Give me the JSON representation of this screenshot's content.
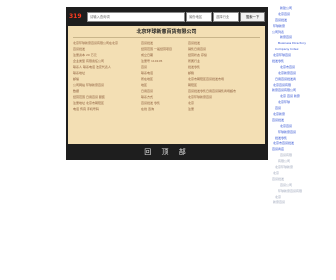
{
  "search": {
    "logo": "319",
    "keyword_placeholder": "请输入查询词",
    "area_placeholder": "省份地区",
    "industry_placeholder": "选择行业",
    "button": "搜索一下"
  },
  "company": {
    "name": "北京环球新意百货有限公司",
    "rows": [
      [
        "北京环球新意百货有限公司在北京",
        "百货批发",
        "百货批发"
      ],
      [
        "百货批发",
        "经营范围 一般经营项目",
        "销售日用百货"
      ],
      [
        "注册资本 20 万元",
        "成立日期",
        "经营状态 存续"
      ],
      [
        "企业类型 有限责任公司",
        "注册号 110105",
        "所属行业"
      ],
      [
        "联系人 联系电话 法定代表人",
        "百货",
        "批发零售"
      ],
      [
        "联系地址",
        "联系电话",
        "邮箱"
      ],
      [
        "邮编",
        "所在地区",
        "北京市朝阳区百货批发市场"
      ],
      [
        "公司网站 环球新意百货",
        "地区",
        "朝阳区"
      ],
      [
        "数据",
        "日用百货",
        "百货批发零售日用百货销售商场超市"
      ],
      [
        "经营范围 日用百货 服装",
        "联系方式",
        "北京环球新意百货"
      ],
      [
        "注册地址 北京市朝阳区",
        "百货批发 零售",
        "北京"
      ],
      [
        "电话 传真 手机号码",
        "在线 咨询",
        "注册"
      ]
    ],
    "footer": "回 顶 部"
  },
  "right_links": [
    "新建公司",
    "北京百货",
    "百货批发",
    "环球新意",
    "公司列表",
    "新意百货",
    "Business Directory",
    "Company Index",
    "北京环球百货",
    "批发零售",
    "北京市百货",
    "北京新意百货",
    "日用百货批发商",
    "北京百货有限",
    "新意百货有限公司",
    "北京 百货 新意",
    "北京环球",
    "百货",
    "北京新意",
    "百货批发",
    "北京百货",
    "环球新意百货",
    "批发零售",
    "北京市百货批发",
    "百货商店",
    "百货有限",
    "有限公司",
    "北京环球新意",
    "北京",
    "百货批发",
    "百货公司",
    "环球新意百货有限",
    "北京",
    "新意百货"
  ]
}
